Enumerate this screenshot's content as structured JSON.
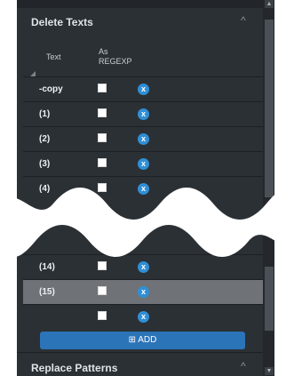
{
  "delete_section": {
    "title": "Delete Texts",
    "col_text": "Text",
    "col_regexp_1": "As",
    "col_regexp_2": "REGEXP"
  },
  "rows_top": [
    {
      "text": "-copy"
    },
    {
      "text": "(1)"
    },
    {
      "text": "(2)"
    },
    {
      "text": "(3)"
    },
    {
      "text": "(4)"
    }
  ],
  "rows_bottom": [
    {
      "text": "(14)"
    },
    {
      "text": "(15)"
    },
    {
      "text": ""
    }
  ],
  "add_button": {
    "label": "ADD",
    "icon": "add-row-icon"
  },
  "replace_section": {
    "title": "Replace Patterns"
  },
  "icons": {
    "remove": "x",
    "chevron": "^",
    "add": "⊞"
  },
  "colors": {
    "panel": "#2b3035",
    "accent": "#2c74b8",
    "remove_icon": "#2f8fd6",
    "highlight_row": "#6f7377"
  }
}
